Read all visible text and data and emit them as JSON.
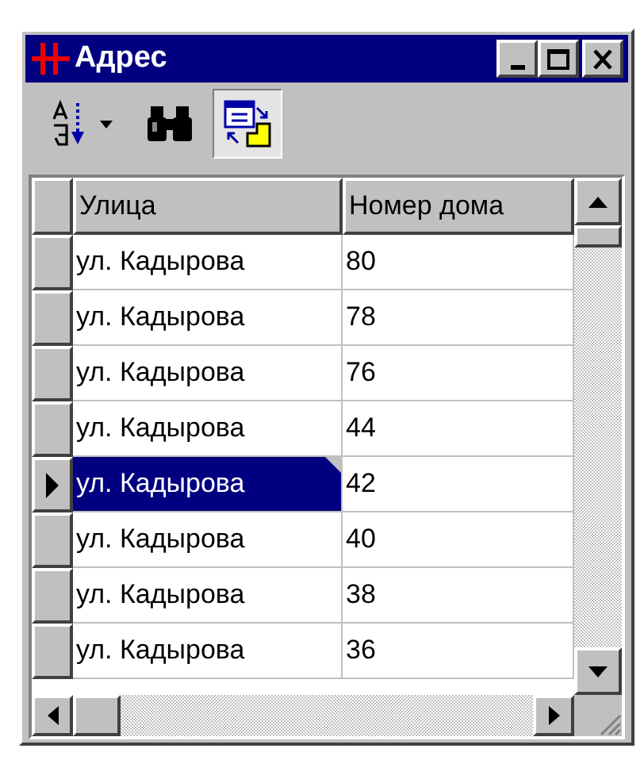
{
  "window": {
    "title": "Адрес"
  },
  "toolbar": [
    {
      "kind": "sort",
      "selected": false
    },
    {
      "kind": "find",
      "selected": false
    },
    {
      "kind": "toggle",
      "selected": true
    }
  ],
  "table": {
    "columns": [
      "Улица",
      "Номер дома"
    ],
    "rows": [
      {
        "cells": [
          "ул. Кадырова",
          "80"
        ],
        "selected": false
      },
      {
        "cells": [
          "ул. Кадырова",
          "78"
        ],
        "selected": false
      },
      {
        "cells": [
          "ул. Кадырова",
          "76"
        ],
        "selected": false
      },
      {
        "cells": [
          "ул. Кадырова",
          "44"
        ],
        "selected": false
      },
      {
        "cells": [
          "ул. Кадырова",
          "42"
        ],
        "selected": true
      },
      {
        "cells": [
          "ул. Кадырова",
          "40"
        ],
        "selected": false
      },
      {
        "cells": [
          "ул. Кадырова",
          "38"
        ],
        "selected": false
      },
      {
        "cells": [
          "ул. Кадырова",
          "36"
        ],
        "selected": false
      }
    ]
  }
}
